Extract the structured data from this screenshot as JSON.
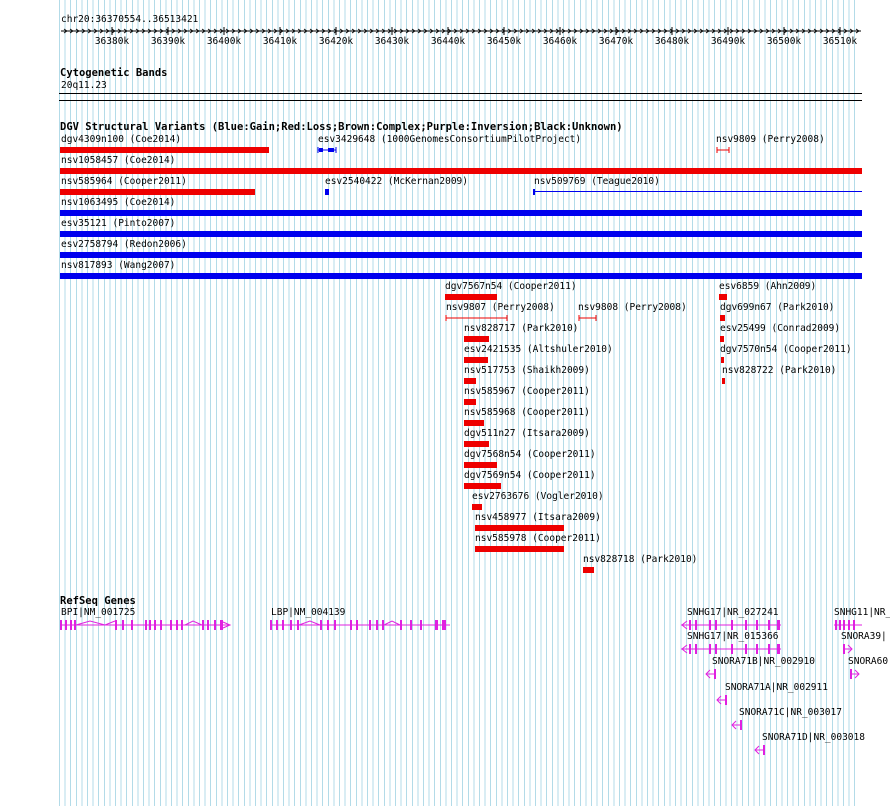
{
  "ruler": {
    "position": "chr20:36370554..36513421",
    "ticks": [
      "36380k",
      "36390k",
      "36400k",
      "36410k",
      "36420k",
      "36430k",
      "36440k",
      "36450k",
      "36460k",
      "36470k",
      "36480k",
      "36490k",
      "36500k",
      "36510k"
    ]
  },
  "cyto": {
    "title": "Cytogenetic Bands",
    "band": "20q11.23"
  },
  "dgv": {
    "title": "DGV Structural Variants (Blue:Gain;Red:Loss;Brown:Complex;Purple:Inversion;Black:Unknown)",
    "colors": {
      "gain": "#0000ee",
      "loss": "#ee0000"
    },
    "features": [
      "dgv4309n100 (Coe2014)",
      "esv3429648 (1000GenomesConsortiumPilotProject)",
      "nsv9809 (Perry2008)",
      "nsv1058457 (Coe2014)",
      "nsv585964 (Cooper2011)",
      "esv2540422 (McKernan2009)",
      "nsv509769 (Teague2010)",
      "nsv1063495 (Coe2014)",
      "esv35121 (Pinto2007)",
      "esv2758794 (Redon2006)",
      "nsv817893 (Wang2007)",
      "dgv7567n54 (Cooper2011)",
      "esv6859 (Ahn2009)",
      "nsv9807 (Perry2008)",
      "nsv9808 (Perry2008)",
      "dgv699n67 (Park2010)",
      "nsv828717 (Park2010)",
      "esv25499 (Conrad2009)",
      "esv2421535 (Altshuler2010)",
      "dgv7570n54 (Cooper2011)",
      "nsv517753 (Shaikh2009)",
      "nsv828722 (Park2010)",
      "nsv585967 (Cooper2011)",
      "nsv585968 (Cooper2011)",
      "dgv511n27 (Itsara2009)",
      "dgv7568n54 (Cooper2011)",
      "dgv7569n54 (Cooper2011)",
      "esv2763676 (Vogler2010)",
      "nsv458977 (Itsara2009)",
      "nsv585978 (Cooper2011)",
      "nsv828718 (Park2010)"
    ]
  },
  "refseq": {
    "title": "RefSeq Genes",
    "gene_color": "#e020e0",
    "genes": [
      "BPI|NM_001725",
      "LBP|NM_004139",
      "SNHG17|NR_027241",
      "SNHG11|NR_",
      "SNHG17|NR_015366",
      "SNORA39|",
      "SNORA71B|NR_002910",
      "SNORA60",
      "SNORA71A|NR_002911",
      "SNORA71C|NR_003017",
      "SNORA71D|NR_003018"
    ]
  }
}
